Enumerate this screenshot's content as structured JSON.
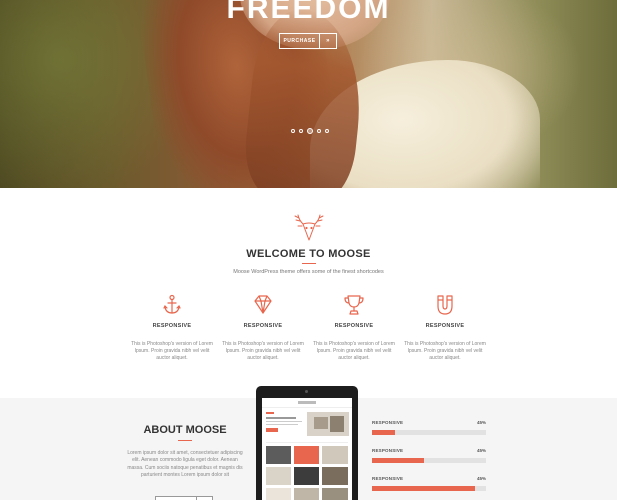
{
  "colors": {
    "accent": "#e8664d",
    "about_bg": "#f5f5f5"
  },
  "hero": {
    "title": "FREEDOM",
    "purchase_label": "PURCHASE",
    "arrow_glyph": "»",
    "slide_count": 5,
    "active_slide": 3
  },
  "welcome": {
    "logo_icon": "deer-antlers-icon",
    "title": "WELCOME TO MOOSE",
    "subtitle": "Moose WordPress theme offers some of the finest shortcodes"
  },
  "features": [
    {
      "icon": "anchor-icon",
      "title": "RESPONSIVE",
      "text": "This is Photoshop's version of Lorem Ipsum. Proin gravida nibh vel velit auctor aliquet."
    },
    {
      "icon": "diamond-icon",
      "title": "RESPONSIVE",
      "text": "This is Photoshop's version of Lorem Ipsum. Proin gravida nibh vel velit auctor aliquet."
    },
    {
      "icon": "trophy-icon",
      "title": "RESPONSIVE",
      "text": "This is Photoshop's version of Lorem Ipsum. Proin gravida nibh vel velit auctor aliquet."
    },
    {
      "icon": "magnet-icon",
      "title": "RESPONSIVE",
      "text": "This is Photoshop's version of Lorem Ipsum. Proin gravida nibh vel velit auctor aliquet."
    }
  ],
  "about": {
    "title": "ABOUT MOOSE",
    "text": "Lorem ipsum dolor sit amet, consectetuer adipiscing elit. Aenean commodo ligula eget dolor. Aenean massa. Cum sociis natoque penatibus et magnis dis parturient montes Lorem ipsum dolor sit"
  },
  "skills": [
    {
      "label": "RESPONSIVE",
      "value_text": "45%",
      "fill": 0.2
    },
    {
      "label": "RESPONSIVE",
      "value_text": "45%",
      "fill": 0.46
    },
    {
      "label": "RESPONSIVE",
      "value_text": "45%",
      "fill": 0.9
    }
  ]
}
